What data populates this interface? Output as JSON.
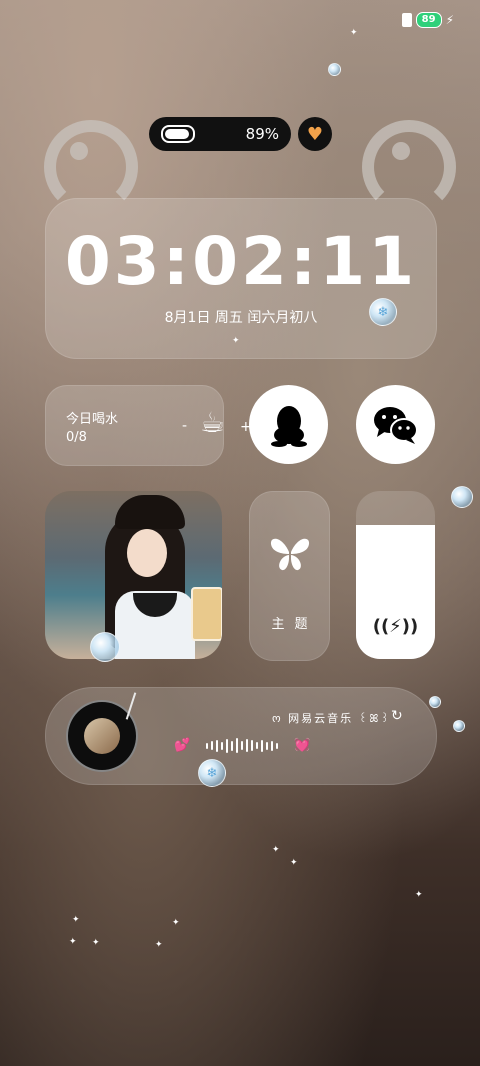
{
  "status_bar": {
    "battery_level": "89",
    "charging_icon": "bolt-icon",
    "sim_icon": "sim-card-icon"
  },
  "battery_widget": {
    "percent": "89%",
    "heart_icon": "heart-icon"
  },
  "clock": {
    "time": "03:02:11",
    "date_line": "8月1日  周五  闰六月初八"
  },
  "water": {
    "title": "今日喝水",
    "count": "0/8",
    "minus": "-",
    "plus": "+",
    "cup_icon": "coffee-cup-icon"
  },
  "apps": {
    "qq_icon": "qq-penguin-icon",
    "wechat_icon": "wechat-icon"
  },
  "theme": {
    "label": "主题",
    "icon": "butterfly-icon"
  },
  "switch": {
    "icon": "wireless-charging-icon",
    "level": 0.8
  },
  "music": {
    "app_label": "ო 网易云音乐 ꒰ꕤ꒱",
    "refresh_icon": "refresh-icon",
    "disc_icon": "vinyl-disc-icon"
  },
  "colors": {
    "accent_orange": "#f2a24a",
    "heart_pink": "#ff4f9a",
    "battery_green": "#2fd07a"
  }
}
